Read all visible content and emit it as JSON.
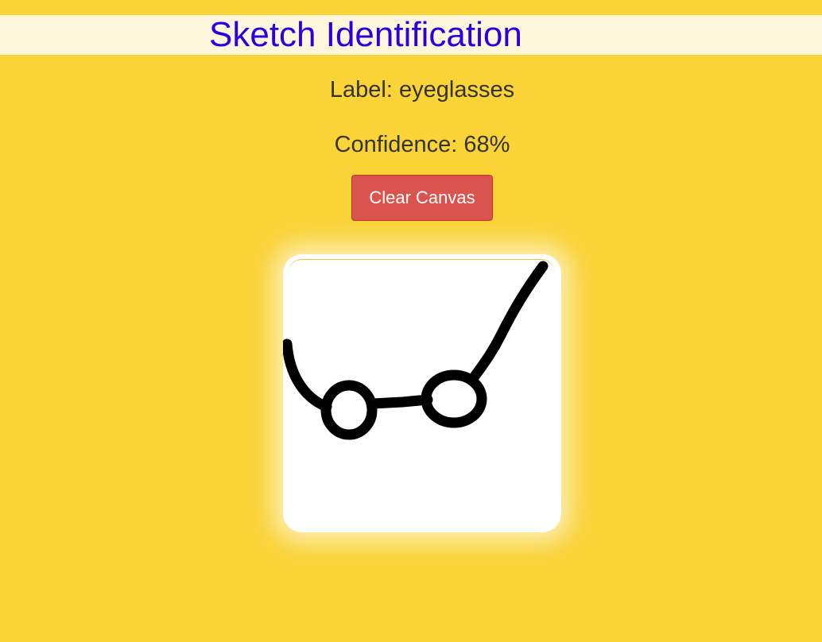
{
  "header": {
    "title": "Sketch Identification"
  },
  "prediction": {
    "label_text": "Label: eyeglasses",
    "confidence_text": "Confidence: 68%"
  },
  "controls": {
    "clear_label": "Clear Canvas"
  },
  "colors": {
    "page_background": "#fad337",
    "title_bar_background": "#fff7dc",
    "title_text": "#2a00e0",
    "clear_button": "#d9534f",
    "stroke": "#000000"
  }
}
